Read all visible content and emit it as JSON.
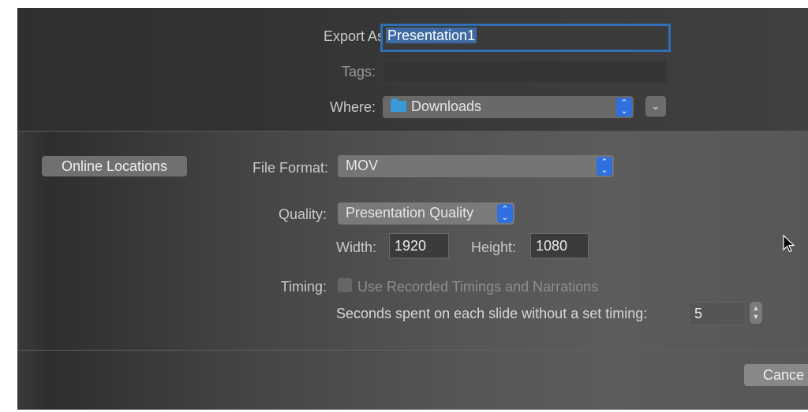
{
  "export_as": {
    "label": "Export As:",
    "value": "Presentation1"
  },
  "tags": {
    "label": "Tags:",
    "value": ""
  },
  "where": {
    "label": "Where:",
    "value": "Downloads",
    "icon": "folder-icon",
    "expand_icon": "chevron-down-icon"
  },
  "online_locations_button": "Online Locations",
  "file_format": {
    "label": "File Format:",
    "value": "MOV"
  },
  "quality": {
    "label": "Quality:",
    "value": "Presentation Quality"
  },
  "width": {
    "label": "Width:",
    "value": "1920"
  },
  "height": {
    "label": "Height:",
    "value": "1080"
  },
  "timing": {
    "label": "Timing:",
    "checkbox_label": "Use Recorded Timings and Narrations",
    "checkbox_checked": false,
    "seconds_label": "Seconds spent on each slide without a set timing:",
    "seconds_value": "5"
  },
  "cancel_button": "Cance",
  "colors": {
    "accent": "#2f6fe0",
    "focus_ring": "#2f6fb5",
    "dialog_bg": "#4a4a4a",
    "text": "#c9c9c9"
  }
}
